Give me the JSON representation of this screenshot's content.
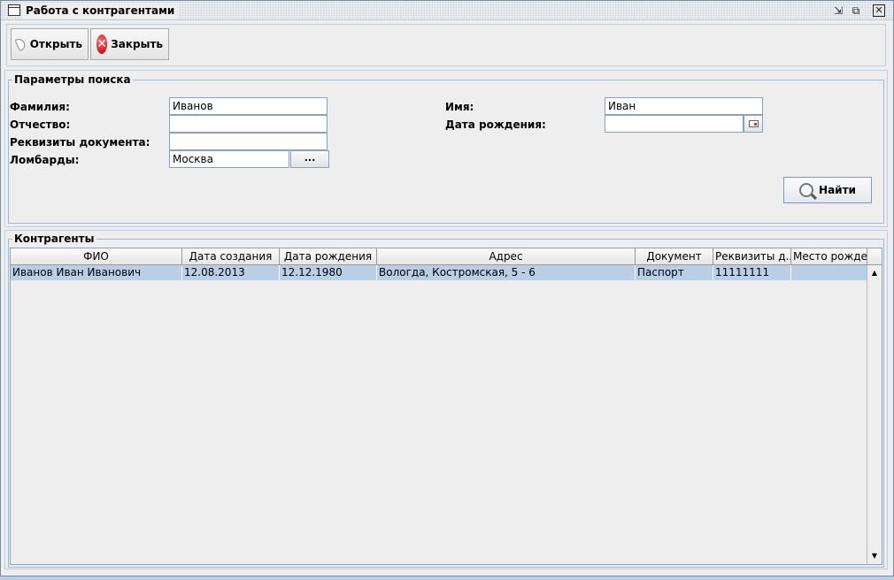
{
  "window": {
    "title": "Работа с контрагентами",
    "controls": {
      "minimize": "⇲",
      "maximize": "⧉",
      "close": "✕"
    }
  },
  "toolbar": {
    "open_label": "Открыть",
    "close_label": "Закрыть",
    "open_icon": "tag-icon",
    "close_icon": "close-circle-icon"
  },
  "search": {
    "group_title": "Параметры поиска",
    "surname_label": "Фамилия:",
    "surname_value": "Иванов",
    "patronymic_label": "Отчество:",
    "patronymic_value": "",
    "doc_label": "Реквизиты документа:",
    "doc_value": "",
    "pawnshops_label": "Ломбарды:",
    "pawnshops_value": "Москва",
    "pawnshops_button": "...",
    "name_label": "Имя:",
    "name_value": "Иван",
    "birthdate_label": "Дата рождения:",
    "birthdate_value": "",
    "find_label": "Найти"
  },
  "contractors": {
    "group_title": "Контрагенты",
    "columns": [
      "ФИО",
      "Дата создания",
      "Дата рождения",
      "Адрес",
      "Документ",
      "Реквизиты д...",
      "Место рожде..."
    ],
    "rows": [
      {
        "fio": "Иванов Иван Иванович",
        "created": "12.08.2013",
        "birth": "12.12.1980",
        "address": "Вологда, Костромская, 5 - 6",
        "document": "Паспорт",
        "doc_details": "11111111",
        "birthplace": ""
      }
    ]
  },
  "colors": {
    "accent": "#b8cfe5",
    "border": "#8aa2bc",
    "background": "#eeeeee"
  }
}
